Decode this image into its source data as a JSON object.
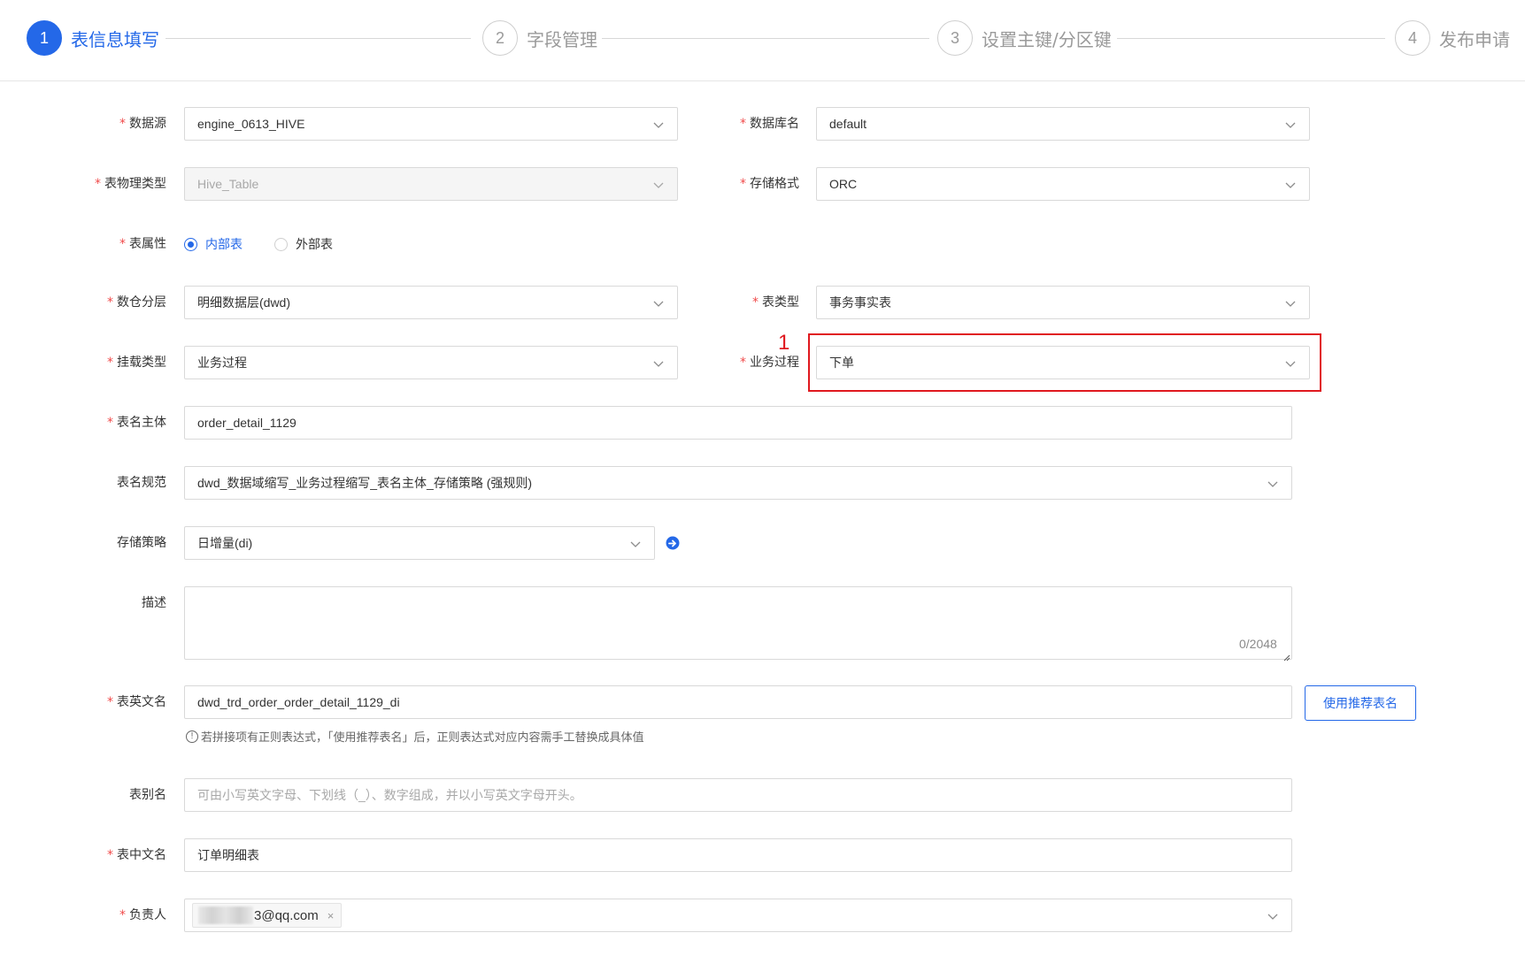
{
  "steps": [
    {
      "num": "1",
      "label": "表信息填写",
      "active": true
    },
    {
      "num": "2",
      "label": "字段管理",
      "active": false
    },
    {
      "num": "3",
      "label": "设置主键/分区键",
      "active": false
    },
    {
      "num": "4",
      "label": "发布申请",
      "active": false
    }
  ],
  "form": {
    "datasource": {
      "label": "数据源",
      "value": "engine_0613_HIVE"
    },
    "database": {
      "label": "数据库名",
      "value": "default"
    },
    "physical_type": {
      "label": "表物理类型",
      "value": "Hive_Table"
    },
    "storage_format": {
      "label": "存储格式",
      "value": "ORC"
    },
    "table_attr": {
      "label": "表属性",
      "options": [
        "内部表",
        "外部表"
      ],
      "selected": "内部表"
    },
    "warehouse_layer": {
      "label": "数仓分层",
      "value": "明细数据层(dwd)"
    },
    "table_type": {
      "label": "表类型",
      "value": "事务事实表"
    },
    "mount_type": {
      "label": "挂载类型",
      "value": "业务过程"
    },
    "business_process": {
      "label": "业务过程",
      "value": "下单"
    },
    "table_subject": {
      "label": "表名主体",
      "value": "order_detail_1129"
    },
    "naming_rule": {
      "label": "表名规范",
      "value": "dwd_数据域缩写_业务过程缩写_表名主体_存储策略  (强规则)"
    },
    "storage_strategy": {
      "label": "存储策略",
      "value": "日增量(di)"
    },
    "description": {
      "label": "描述",
      "value": "",
      "counter": "0/2048"
    },
    "english_name": {
      "label": "表英文名",
      "value": "dwd_trd_order_order_detail_1129_di",
      "button": "使用推荐表名",
      "hint": "若拼接项有正则表达式，「使用推荐表名」后，正则表达式对应内容需手工替换成具体值"
    },
    "alias": {
      "label": "表别名",
      "placeholder": "可由小写英文字母、下划线（_）、数字组成，并以小写英文字母开头。"
    },
    "chinese_name": {
      "label": "表中文名",
      "value": "订单明细表"
    },
    "owner": {
      "label": "负责人",
      "tag": "3@qq.com"
    }
  },
  "annotation": {
    "number": "1"
  },
  "colors": {
    "primary": "#2468e8",
    "required": "#f04a4a",
    "annotation": "#e0191f"
  }
}
